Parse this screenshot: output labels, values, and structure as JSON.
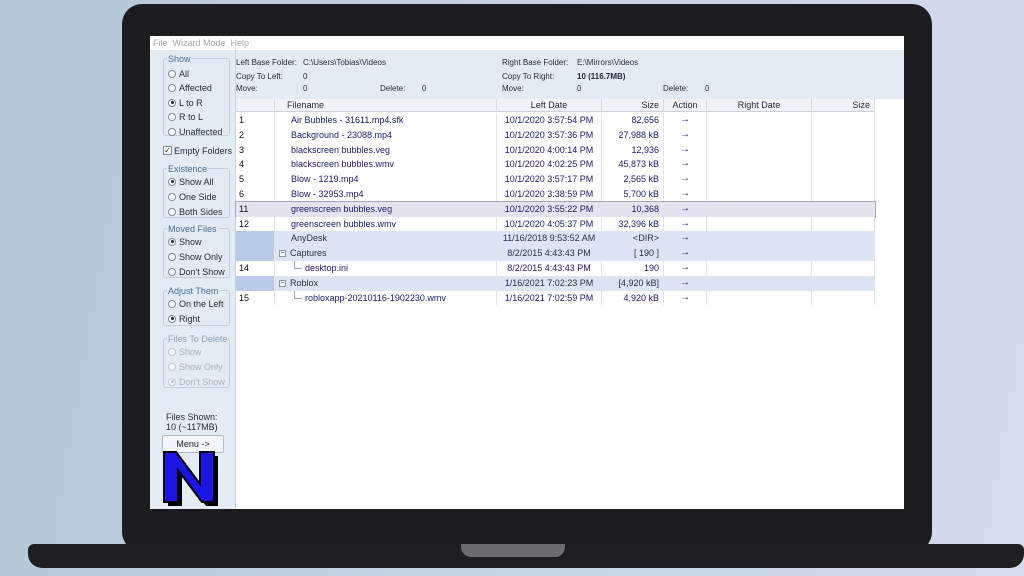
{
  "menu": [
    "File",
    "Wizard Mode",
    "Help"
  ],
  "show_group": {
    "title": "Show",
    "options": [
      {
        "label": "All",
        "checked": false
      },
      {
        "label": "Affected",
        "checked": false
      },
      {
        "label": "L to R",
        "checked": true
      },
      {
        "label": "R to L",
        "checked": false
      },
      {
        "label": "Unaffected",
        "checked": false
      }
    ]
  },
  "empty_folders": {
    "label": "Empty Folders",
    "checked": true
  },
  "existence_group": {
    "title": "Existence",
    "options": [
      {
        "label": "Show All",
        "checked": true
      },
      {
        "label": "One Side",
        "checked": false
      },
      {
        "label": "Both Sides",
        "checked": false
      }
    ]
  },
  "moved_group": {
    "title": "Moved Files",
    "options": [
      {
        "label": "Show",
        "checked": true
      },
      {
        "label": "Show Only",
        "checked": false
      },
      {
        "label": "Don't Show",
        "checked": false
      }
    ]
  },
  "adjust_group": {
    "title": "Adjust Them",
    "options": [
      {
        "label": "On the Left",
        "checked": false
      },
      {
        "label": "Right",
        "checked": true
      }
    ]
  },
  "delete_group": {
    "title": "Files To Delete",
    "options": [
      {
        "label": "Show",
        "checked": false
      },
      {
        "label": "Show Only",
        "checked": false
      },
      {
        "label": "Don't Show",
        "checked": true
      }
    ]
  },
  "files_shown": {
    "label": "Files Shown:",
    "value": "10 (~117MB)"
  },
  "menu_button": "Menu ->",
  "info": {
    "left_base_label": "Left Base Folder:",
    "left_base_value": "C:\\Users\\Tobias\\Videos",
    "right_base_label": "Right Base Folder:",
    "right_base_value": "E:\\Mirrors\\Videos",
    "copy_to_left_label": "Copy To Left:",
    "copy_to_left_value": "0",
    "copy_to_right_label": "Copy To Right:",
    "copy_to_right_value": "10 (116.7MB)",
    "move_left_label": "Move:",
    "move_left_value": "0",
    "delete_left_label": "Delete:",
    "delete_left_value": "0",
    "move_right_label": "Move:",
    "move_right_value": "0",
    "delete_right_label": "Delete:",
    "delete_right_value": "0"
  },
  "columns": [
    "",
    "Filename",
    "Left Date",
    "Size",
    "Action",
    "Right Date",
    "Size"
  ],
  "rows": [
    {
      "num": "1",
      "name": "Air Bubbles - 31611.mp4.sfk",
      "date": "10/1/2020 3:57:54 PM",
      "size": "82,656",
      "action": "→",
      "indent": 0,
      "folder": false
    },
    {
      "num": "2",
      "name": "Background - 23088.mp4",
      "date": "10/1/2020 3:57:36 PM",
      "size": "27,988 kB",
      "action": "→",
      "indent": 0,
      "folder": false
    },
    {
      "num": "3",
      "name": "blackscreen bubbles.veg",
      "date": "10/1/2020 4:00:14 PM",
      "size": "12,936",
      "action": "→",
      "indent": 0,
      "folder": false
    },
    {
      "num": "4",
      "name": "blackscreen bubbles.wmv",
      "date": "10/1/2020 4:02:25 PM",
      "size": "45,873 kB",
      "action": "→",
      "indent": 0,
      "folder": false
    },
    {
      "num": "5",
      "name": "Blow - 1219.mp4",
      "date": "10/1/2020 3:57:17 PM",
      "size": "2,565 kB",
      "action": "→",
      "indent": 0,
      "folder": false
    },
    {
      "num": "6",
      "name": "Blow - 32953.mp4",
      "date": "10/1/2020 3:38:59 PM",
      "size": "5,700 kB",
      "action": "→",
      "indent": 0,
      "folder": false
    },
    {
      "num": "11",
      "name": "greenscreen bubbles.veg",
      "date": "10/1/2020 3:55:22 PM",
      "size": "10,368",
      "action": "→",
      "indent": 0,
      "folder": false,
      "selected": true
    },
    {
      "num": "12",
      "name": "greenscreen bubbles.wmv",
      "date": "10/1/2020 4:05:37 PM",
      "size": "32,396 kB",
      "action": "→",
      "indent": 0,
      "folder": false
    },
    {
      "num": "",
      "name": "AnyDesk",
      "date": "11/16/2018 9:53:52 AM",
      "size": "<DIR>",
      "action": "→",
      "indent": 0,
      "folder": true,
      "expander": ""
    },
    {
      "num": "",
      "name": "Captures",
      "date": "8/2/2015 4:43:43 PM",
      "size": "[ 190 ]",
      "action": "→",
      "indent": 0,
      "folder": true,
      "expander": "−"
    },
    {
      "num": "14",
      "name": "desktop.ini",
      "date": "8/2/2015 4:43:43 PM",
      "size": "190",
      "action": "→",
      "indent": 1,
      "folder": false
    },
    {
      "num": "",
      "name": "Roblox",
      "date": "1/16/2021 7:02:23 PM",
      "size": "[4,920 kB]",
      "action": "→",
      "indent": 0,
      "folder": true,
      "expander": "−"
    },
    {
      "num": "15",
      "name": "robloxapp-20210116-1902230.wmv",
      "date": "1/16/2021 7:02:59 PM",
      "size": "4,920 kB",
      "action": "→",
      "indent": 1,
      "folder": false
    }
  ]
}
